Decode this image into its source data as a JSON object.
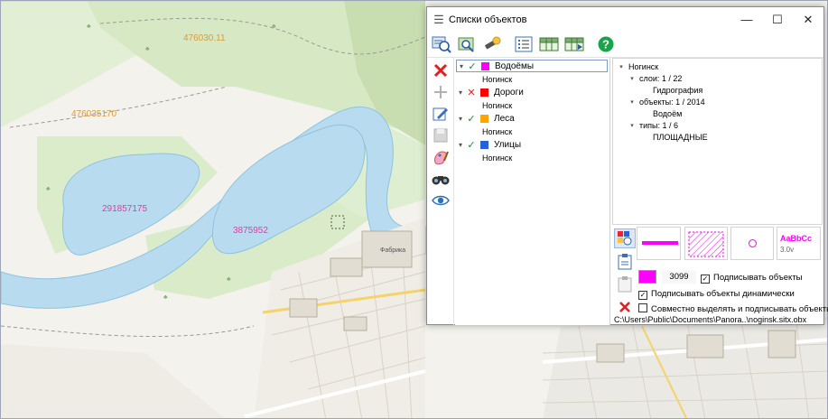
{
  "window": {
    "title": "Списки объектов",
    "controls": {
      "minimize": "—",
      "maximize": "☐",
      "close": "✕"
    }
  },
  "map": {
    "labels": [
      {
        "text": "476030.11",
        "color": "#d89b3e"
      },
      {
        "text": "476035170",
        "color": "#d89b3e"
      },
      {
        "text": "291857175",
        "color": "#e33ca3"
      },
      {
        "text": "3875952",
        "color": "#e33ca3"
      },
      {
        "text": "Фабрика",
        "color": "#555555"
      }
    ]
  },
  "toolbar": {
    "buttons": [
      "search-map-icon",
      "search-layers-icon",
      "flashlight-icon",
      "list-view-icon",
      "table-export-icon",
      "table-import-icon",
      "help-icon"
    ]
  },
  "lefttools": {
    "buttons": [
      "delete-icon",
      "add-icon",
      "edit-icon",
      "save-icon",
      "color-icon",
      "binoculars-icon",
      "eye-icon"
    ]
  },
  "lists": {
    "items": [
      {
        "name": "Водоёмы",
        "state": "✓",
        "color": "#ff00ff",
        "sub": "Ногинск"
      },
      {
        "name": "Дороги",
        "state": "✕",
        "color": "#ff0000",
        "sub": "Ногинск"
      },
      {
        "name": "Леса",
        "state": "✓",
        "color": "#ffa500",
        "sub": "Ногинск"
      },
      {
        "name": "Улицы",
        "state": "✓",
        "color": "#2a62d4",
        "sub": "Ногинск"
      }
    ]
  },
  "tree": {
    "root": "Ногинск",
    "layers": "слои: 1 / 22",
    "layer_name": "Гидрография",
    "objects": "объекты: 1 / 2014",
    "object_name": "Водоём",
    "types": "типы: 1 / 6",
    "type_name": "ПЛОЩАДНЫЕ"
  },
  "style_preview": {
    "text_sample": "AaBbCc",
    "text_size": "3.0v"
  },
  "options": {
    "color": "#ff00ff",
    "number": "3099",
    "label_objects": "Подписывать объекты",
    "label_dynamic": "Подписывать объекты динамически",
    "select_and_label": "Совместно выделять и подписывать объекты"
  },
  "status": {
    "path": "C:\\Users\\Public\\Documents\\Panora..\\noginsk.sitx.obx"
  }
}
